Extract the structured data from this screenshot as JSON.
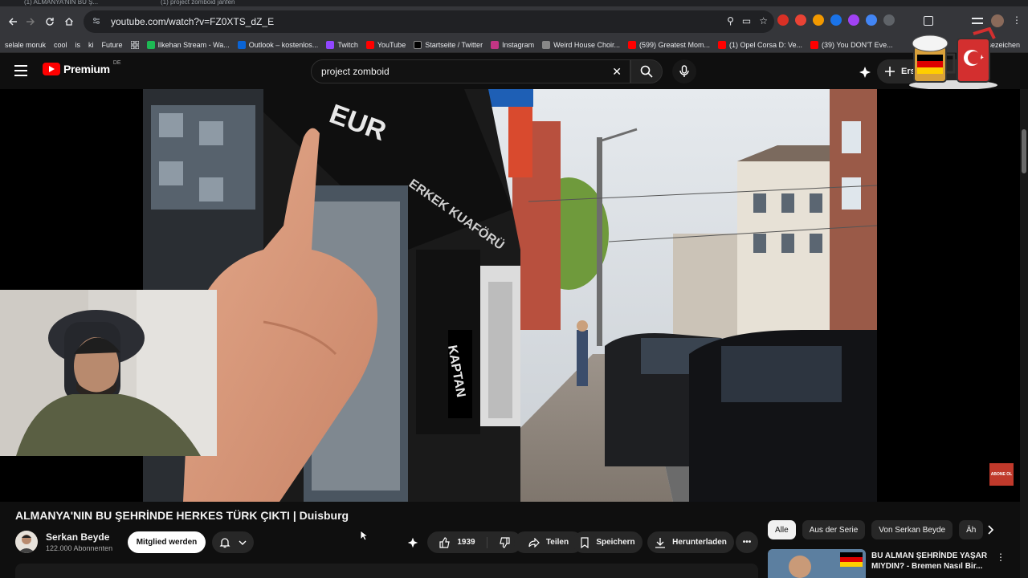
{
  "browser": {
    "tabs": [
      "(1) ALMANYA'NIN BU Ş...",
      "(1) project zomboid janfen"
    ],
    "url": "youtube.com/watch?v=FZ0XTS_dZ_E"
  },
  "bookmarks": [
    {
      "label": "selale moruk",
      "color": ""
    },
    {
      "label": "cool",
      "color": ""
    },
    {
      "label": "is",
      "color": ""
    },
    {
      "label": "ki",
      "color": ""
    },
    {
      "label": "Future",
      "color": ""
    },
    {
      "label": "Ilkehan Stream - Wa...",
      "color": "#1db954"
    },
    {
      "label": "Outlook – kostenlos...",
      "color": "#0a64d6"
    },
    {
      "label": "Twitch",
      "color": "#9146ff"
    },
    {
      "label": "YouTube",
      "color": "#ff0000"
    },
    {
      "label": "Startseite / Twitter",
      "color": "#000000"
    },
    {
      "label": "Instagram",
      "color": "#c13584"
    },
    {
      "label": "Weird House Choir...",
      "color": "#888888"
    },
    {
      "label": "(599) Greatest Mom...",
      "color": "#ff0000"
    },
    {
      "label": "(1) Opel Corsa D: Ve...",
      "color": "#ff0000"
    },
    {
      "label": "(39) You DON'T Eve...",
      "color": "#ff0000"
    }
  ],
  "bookmarks_more": "esezeichen",
  "youtube": {
    "logo_text": "Premium",
    "region": "DE",
    "search_value": "project zomboid",
    "create_label": "Erst"
  },
  "video": {
    "title": "ALMANYA'NIN BU ŞEHRİNDE HERKES TÜRK ÇIKTI | Duisburg",
    "sticker_text": "ABONE OL",
    "scene_text_1": "EUR",
    "scene_text_2": "ERKEK KUAFÖRÜ",
    "scene_text_3": "KAPTAN"
  },
  "channel": {
    "name": "Serkan Beyde",
    "subscribers": "122.000 Abonnenten",
    "join_label": "Mitglied werden"
  },
  "actions": {
    "likes": "1939",
    "share_label": "Teilen",
    "save_label": "Speichern",
    "download_label": "Herunterladen"
  },
  "chips": [
    "Alle",
    "Aus der Serie",
    "Von Serkan Beyde",
    "Äh"
  ],
  "recommendation": {
    "title": "BU ALMAN ŞEHRİNDE YAŞAR MIYDIN? - Bremen Nasıl Bir..."
  },
  "colors": {
    "accent": "#ff0000",
    "background": "#0f0f0f",
    "chip_bg": "#272727"
  }
}
